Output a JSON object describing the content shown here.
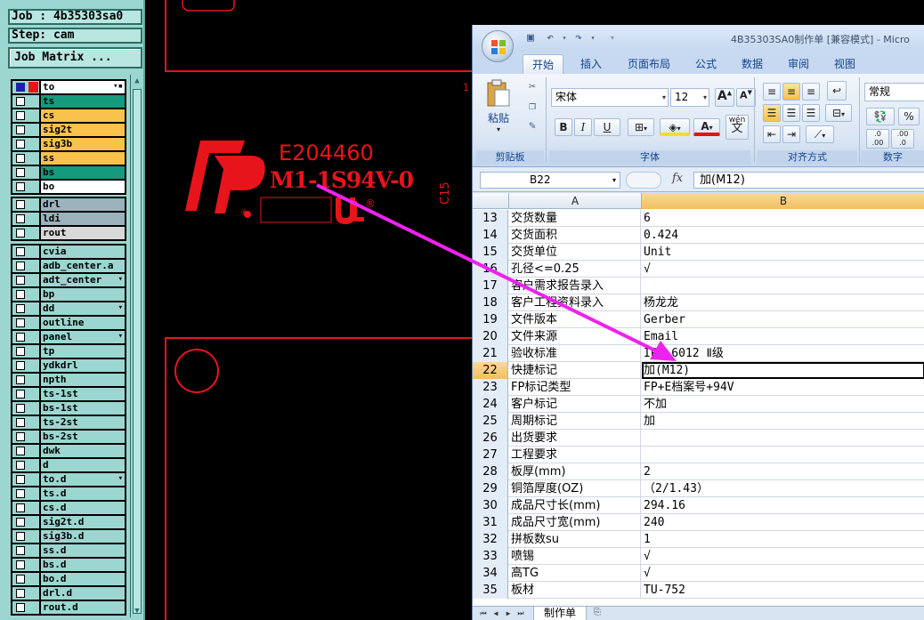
{
  "cam": {
    "job_label": "Job : 4b35303sa0",
    "step_label": "Step: cam",
    "job_matrix_button": "Job Matrix ...",
    "layer_groups": [
      [
        {
          "name": "to",
          "color": "white",
          "active": true,
          "flag": "▾▪"
        },
        {
          "name": "ts",
          "color": "green"
        },
        {
          "name": "cs",
          "color": "orange"
        },
        {
          "name": "sig2t",
          "color": "orange"
        },
        {
          "name": "sig3b",
          "color": "orange"
        },
        {
          "name": "ss",
          "color": "orange"
        },
        {
          "name": "bs",
          "color": "green"
        },
        {
          "name": "bo",
          "color": "white"
        }
      ],
      [
        {
          "name": "drl",
          "color": "steel"
        },
        {
          "name": "ldi",
          "color": "steel"
        },
        {
          "name": "rout",
          "color": "grey"
        }
      ],
      [
        {
          "name": "cvia",
          "color": "cyan"
        },
        {
          "name": "adb_center.a",
          "color": "cyan"
        },
        {
          "name": "adt_center",
          "color": "cyan",
          "flag": "▾"
        },
        {
          "name": "bp",
          "color": "cyan"
        },
        {
          "name": "dd",
          "color": "cyan",
          "flag": "▾"
        },
        {
          "name": "outline",
          "color": "cyan"
        },
        {
          "name": "panel",
          "color": "cyan",
          "flag": "▾"
        },
        {
          "name": "tp",
          "color": "cyan"
        },
        {
          "name": "ydkdrl",
          "color": "cyan"
        },
        {
          "name": "npth",
          "color": "cyan"
        },
        {
          "name": "ts-1st",
          "color": "cyan"
        },
        {
          "name": "bs-1st",
          "color": "cyan"
        },
        {
          "name": "ts-2st",
          "color": "cyan"
        },
        {
          "name": "bs-2st",
          "color": "cyan"
        },
        {
          "name": "dwk",
          "color": "cyan"
        },
        {
          "name": "d",
          "color": "cyan"
        },
        {
          "name": "to.d",
          "color": "cyan",
          "flag": "▾"
        },
        {
          "name": "ts.d",
          "color": "cyan"
        },
        {
          "name": "cs.d",
          "color": "cyan"
        },
        {
          "name": "sig2t.d",
          "color": "cyan"
        },
        {
          "name": "sig3b.d",
          "color": "cyan"
        },
        {
          "name": "ss.d",
          "color": "cyan"
        },
        {
          "name": "bs.d",
          "color": "cyan"
        },
        {
          "name": "bo.d",
          "color": "cyan"
        },
        {
          "name": "drl.d",
          "color": "cyan"
        },
        {
          "name": "rout.d",
          "color": "cyan"
        }
      ]
    ],
    "canvas": {
      "ul_code": "E204460",
      "marking": "M1-1S94V-0",
      "side_label": "C15",
      "edge_mark": "1",
      "reg_mark": "®",
      "reg_mark2": "®"
    },
    "colors": {
      "trace": "#e8141b",
      "arrow": "#ee22ee"
    }
  },
  "excel": {
    "window_title": "4B35303SA0制作单  [兼容模式] - Micro",
    "tabs": [
      "开始",
      "插入",
      "页面布局",
      "公式",
      "数据",
      "审阅",
      "视图"
    ],
    "active_tab": "开始",
    "ribbon": {
      "paste_label": "粘贴",
      "clipboard_group": "剪贴板",
      "font_group": "字体",
      "align_group": "对齐方式",
      "number_group": "数字",
      "font_name": "宋体",
      "font_size": "12",
      "number_format": "常规",
      "bold": "B",
      "italic": "I",
      "underline": "U",
      "grow_font": "A",
      "shrink_font": "A",
      "font_color_letter": "A",
      "wen_label": "wén",
      "wen_char": "文",
      "percent": "%",
      "dec_inc": ".00",
      "dec_dec": ".0"
    },
    "name_box": "B22",
    "fx": "fx",
    "formula": "加(M12)",
    "columns": [
      "A",
      "B"
    ],
    "rows": [
      {
        "n": "13",
        "a": "交货数量",
        "b": "6"
      },
      {
        "n": "14",
        "a": "交货面积",
        "b": "0.424"
      },
      {
        "n": "15",
        "a": "交货单位",
        "b": "Unit"
      },
      {
        "n": "16",
        "a": "孔径<=0.25",
        "b": "√"
      },
      {
        "n": "17",
        "a": "客户需求报告录入",
        "b": ""
      },
      {
        "n": "18",
        "a": "客户工程资料录入",
        "b": "杨龙龙"
      },
      {
        "n": "19",
        "a": "文件版本",
        "b": "Gerber"
      },
      {
        "n": "20",
        "a": "文件来源",
        "b": "Email"
      },
      {
        "n": "21",
        "a": "验收标准",
        "b": "IPC-6012 Ⅱ级"
      },
      {
        "n": "22",
        "a": "快捷标记",
        "b": "加(M12)",
        "selected": true
      },
      {
        "n": "23",
        "a": "FP标记类型",
        "b": "FP+E档案号+94V"
      },
      {
        "n": "24",
        "a": "客户标记",
        "b": "不加"
      },
      {
        "n": "25",
        "a": "周期标记",
        "b": "加"
      },
      {
        "n": "26",
        "a": "出货要求",
        "b": ""
      },
      {
        "n": "27",
        "a": "工程要求",
        "b": ""
      },
      {
        "n": "28",
        "a": "板厚(mm)",
        "b": "2"
      },
      {
        "n": "29",
        "a": "铜箔厚度(OZ)",
        "b": "（2/1.43）"
      },
      {
        "n": "30",
        "a": "成品尺寸长(mm)",
        "b": "294.16"
      },
      {
        "n": "31",
        "a": "成品尺寸宽(mm)",
        "b": "240"
      },
      {
        "n": "32",
        "a": "拼板数su",
        "b": "1"
      },
      {
        "n": "33",
        "a": "喷锡",
        "b": "√"
      },
      {
        "n": "34",
        "a": "高TG",
        "b": "√"
      },
      {
        "n": "35",
        "a": "板材",
        "b": "TU-752"
      }
    ],
    "sheet_tab": "制作单"
  }
}
